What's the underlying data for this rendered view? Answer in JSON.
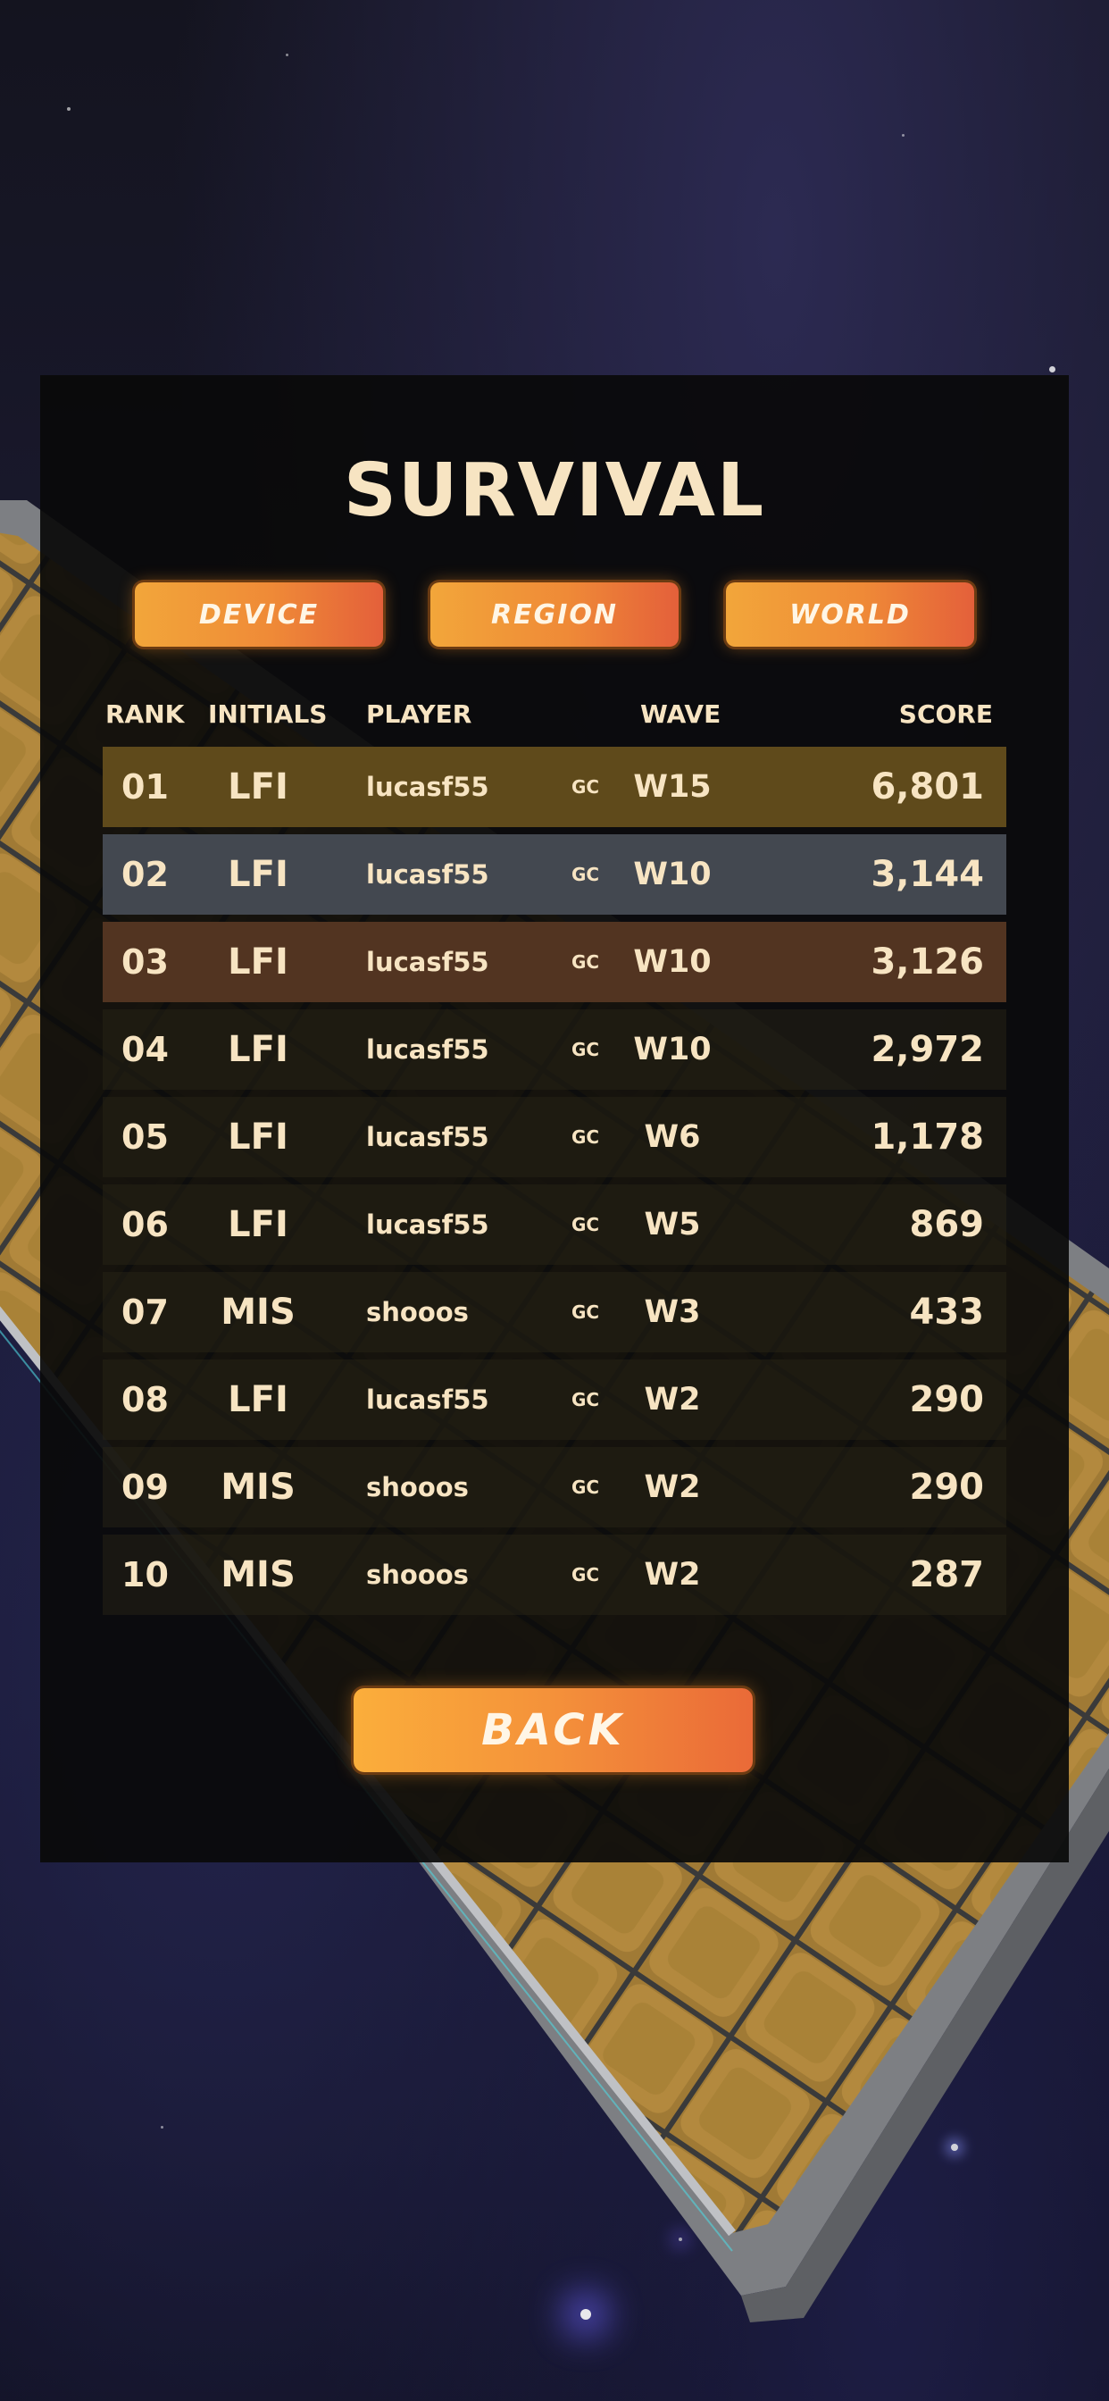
{
  "title": "SURVIVAL",
  "tabs": [
    {
      "label": "DEVICE"
    },
    {
      "label": "REGION"
    },
    {
      "label": "WORLD"
    }
  ],
  "headers": {
    "rank": "RANK",
    "initials": "INITIALS",
    "player": "PLAYER",
    "wave": "WAVE",
    "score": "SCORE"
  },
  "rows": [
    {
      "rank": "01",
      "initials": "LFI",
      "player": "lucasf55",
      "badge": "GC",
      "wave": "W15",
      "score": "6,801",
      "tier": "gold"
    },
    {
      "rank": "02",
      "initials": "LFI",
      "player": "lucasf55",
      "badge": "GC",
      "wave": "W10",
      "score": "3,144",
      "tier": "silver"
    },
    {
      "rank": "03",
      "initials": "LFI",
      "player": "lucasf55",
      "badge": "GC",
      "wave": "W10",
      "score": "3,126",
      "tier": "bronze"
    },
    {
      "rank": "04",
      "initials": "LFI",
      "player": "lucasf55",
      "badge": "GC",
      "wave": "W10",
      "score": "2,972",
      "tier": "normal"
    },
    {
      "rank": "05",
      "initials": "LFI",
      "player": "lucasf55",
      "badge": "GC",
      "wave": "W6",
      "score": "1,178",
      "tier": "normal"
    },
    {
      "rank": "06",
      "initials": "LFI",
      "player": "lucasf55",
      "badge": "GC",
      "wave": "W5",
      "score": "869",
      "tier": "normal"
    },
    {
      "rank": "07",
      "initials": "MIS",
      "player": "shooos",
      "badge": "GC",
      "wave": "W3",
      "score": "433",
      "tier": "normal"
    },
    {
      "rank": "08",
      "initials": "LFI",
      "player": "lucasf55",
      "badge": "GC",
      "wave": "W2",
      "score": "290",
      "tier": "normal"
    },
    {
      "rank": "09",
      "initials": "MIS",
      "player": "shooos",
      "badge": "GC",
      "wave": "W2",
      "score": "290",
      "tier": "normal"
    },
    {
      "rank": "10",
      "initials": "MIS",
      "player": "shooos",
      "badge": "GC",
      "wave": "W2",
      "score": "287",
      "tier": "normal"
    }
  ],
  "back_label": "BACK",
  "colors": {
    "text": "#f7e4c2",
    "button_start": "#f2a63a",
    "button_end": "#e4603a",
    "gold_row": "#5f4a1b",
    "silver_row": "#434850",
    "bronze_row": "#523421"
  }
}
